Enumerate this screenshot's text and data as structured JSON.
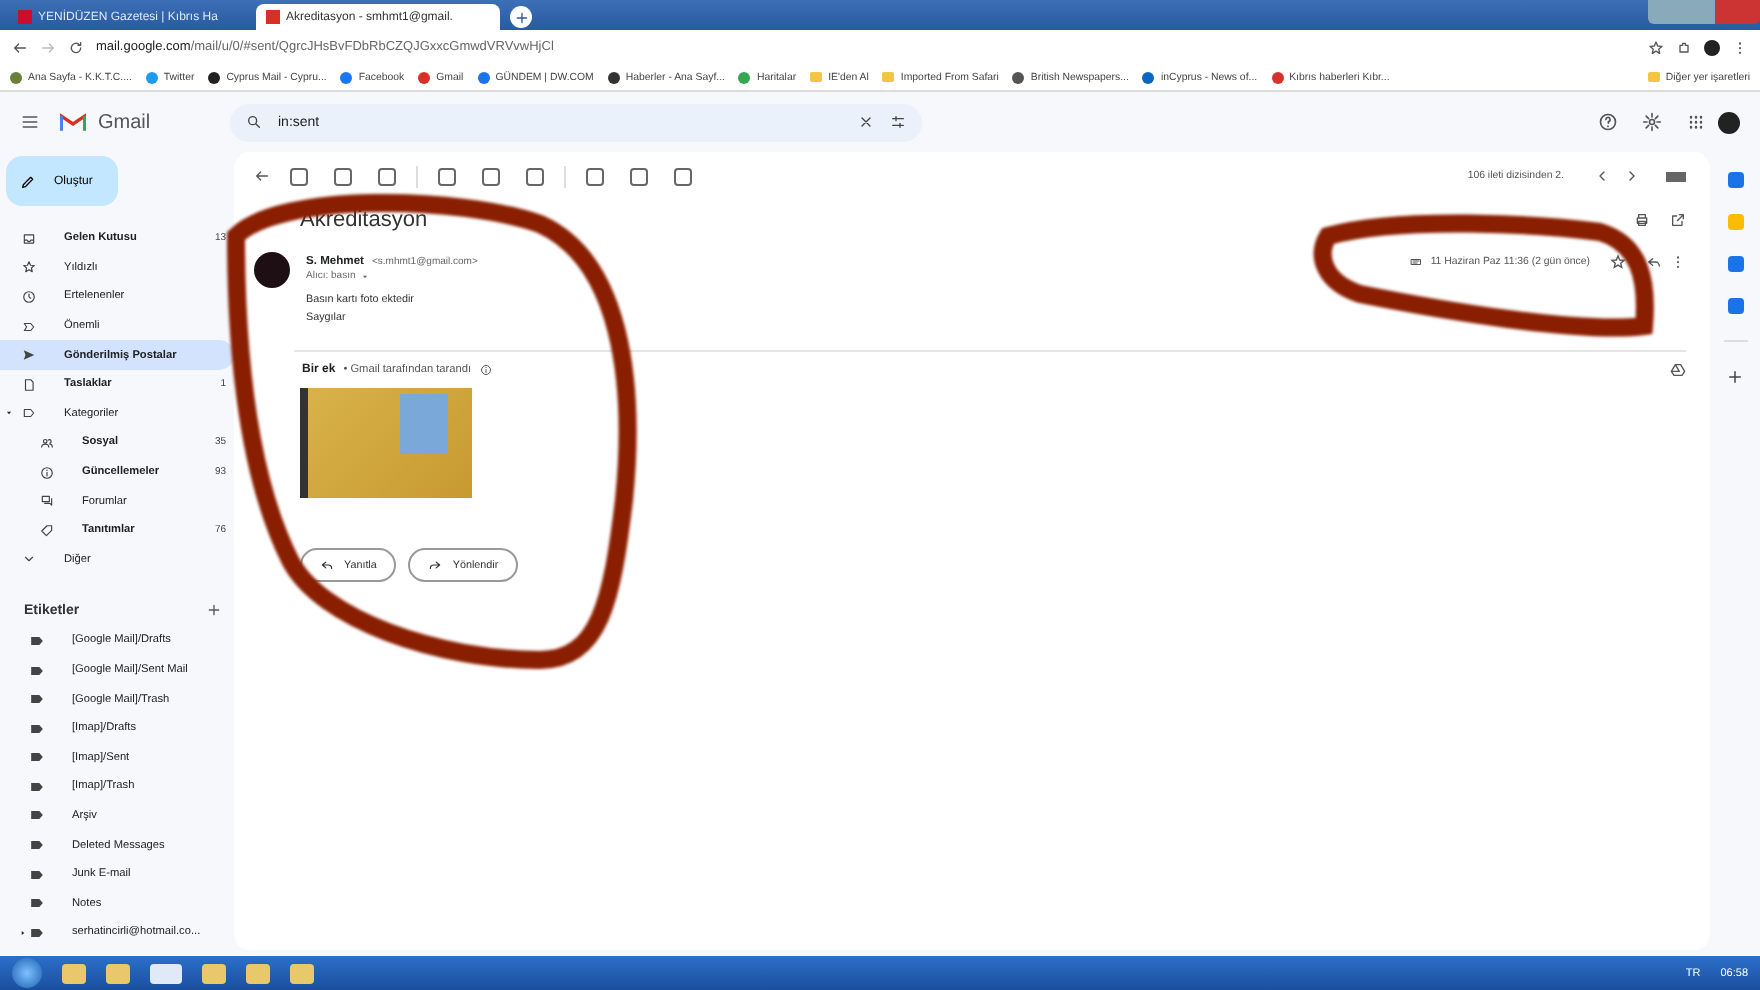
{
  "browser": {
    "tabs": [
      {
        "title": "YENİDÜZEN Gazetesi | Kıbrıs Ha",
        "selected": false
      },
      {
        "title": "Akreditasyon - smhmt1@gmail.",
        "selected": true
      }
    ],
    "address": {
      "host": "mail.google.com",
      "path": "/mail/u/0/#sent/QgrcJHsBvFDbRbCZQJGxxcGmwdVRVvwHjCl"
    },
    "bookmarks": [
      {
        "label": "Ana Sayfa - K.K.T.C....",
        "kind": "site",
        "color": "#6a7f3a"
      },
      {
        "label": "Twitter",
        "kind": "site",
        "color": "#1d9bf0"
      },
      {
        "label": "Cyprus Mail - Cypru...",
        "kind": "site",
        "color": "#222222"
      },
      {
        "label": "Facebook",
        "kind": "site",
        "color": "#1877f2"
      },
      {
        "label": "Gmail",
        "kind": "site",
        "color": "#d93025"
      },
      {
        "label": "GÜNDEM | DW.COM",
        "kind": "site",
        "color": "#1a73e8"
      },
      {
        "label": "Haberler - Ana Sayf...",
        "kind": "site",
        "color": "#333333"
      },
      {
        "label": "Haritalar",
        "kind": "site",
        "color": "#34a853"
      },
      {
        "label": "IE'den Al",
        "kind": "folder",
        "color": "#f4c542"
      },
      {
        "label": "Imported From Safari",
        "kind": "folder",
        "color": "#f4c542"
      },
      {
        "label": "British Newspapers...",
        "kind": "site",
        "color": "#555555"
      },
      {
        "label": "inCyprus - News of...",
        "kind": "site",
        "color": "#0a66c2"
      },
      {
        "label": "Kıbrıs haberleri Kıbr...",
        "kind": "site",
        "color": "#d4322c"
      }
    ],
    "more_bookmarks": "Diğer yer işaretleri"
  },
  "gmail": {
    "app": "Gmail",
    "search": {
      "value": "in:sent"
    },
    "compose": "Oluştur",
    "sidebar": [
      {
        "label": "Gelen Kutusu",
        "count": "13",
        "bold": true,
        "selected": false,
        "kind": "inbox"
      },
      {
        "label": "Yıldızlı",
        "bold": false,
        "selected": false,
        "kind": "star"
      },
      {
        "label": "Ertelenenler",
        "bold": false,
        "selected": false,
        "kind": "clock"
      },
      {
        "label": "Önemli",
        "bold": false,
        "selected": false,
        "kind": "important"
      },
      {
        "label": "Gönderilmiş Postalar",
        "bold": true,
        "selected": true,
        "kind": "send"
      },
      {
        "label": "Taslaklar",
        "count": "1",
        "bold": true,
        "selected": false,
        "kind": "draft"
      },
      {
        "label": "Kategoriler",
        "bold": false,
        "selected": false,
        "kind": "label",
        "expanded": true,
        "children": [
          {
            "label": "Sosyal",
            "count": "35",
            "bold": true,
            "selected": false,
            "kind": "people"
          },
          {
            "label": "Güncellemeler",
            "count": "93",
            "bold": true,
            "selected": false,
            "kind": "info"
          },
          {
            "label": "Forumlar",
            "bold": false,
            "selected": false,
            "kind": "forum"
          },
          {
            "label": "Tanıtımlar",
            "count": "76",
            "bold": true,
            "selected": false,
            "kind": "tag"
          }
        ]
      },
      {
        "label": "Diğer",
        "bold": false,
        "selected": false,
        "kind": "chevron"
      }
    ],
    "labels": {
      "title": "Etiketler",
      "items": [
        {
          "label": "[Google Mail]/Drafts",
          "expandable": false
        },
        {
          "label": "[Google Mail]/Sent Mail",
          "expandable": false
        },
        {
          "label": "[Google Mail]/Trash",
          "expandable": false
        },
        {
          "label": "[Imap]/Drafts",
          "expandable": false
        },
        {
          "label": "[Imap]/Sent",
          "expandable": false
        },
        {
          "label": "[Imap]/Trash",
          "expandable": false
        },
        {
          "label": "Arşiv",
          "expandable": false
        },
        {
          "label": "Deleted Messages",
          "expandable": false
        },
        {
          "label": "Junk E-mail",
          "expandable": false
        },
        {
          "label": "Notes",
          "expandable": false
        },
        {
          "label": "serhatincirli@hotmail.co...",
          "expandable": true
        }
      ]
    },
    "message": {
      "pager": "106 ileti dizisinden 2.",
      "subject": "Akreditasyon",
      "sender_name": "S. Mehmet",
      "sender_email": "<s.mhmt1@gmail.com>",
      "recipient": "Alıcı: basın",
      "date": "11 Haziran Paz 11:36 (2 gün önce)",
      "starred": false,
      "body": [
        "Basın kartı foto ektedir",
        "Saygılar"
      ],
      "attachments_title": "Bir ek",
      "scan_note": "• Gmail tarafından tarandı",
      "actions": [
        {
          "label": "Yanıtla",
          "kind": "reply"
        },
        {
          "label": "Yönlendir",
          "kind": "forward"
        }
      ]
    }
  },
  "taskbar": {
    "language": "TR",
    "clock": "06:58"
  }
}
